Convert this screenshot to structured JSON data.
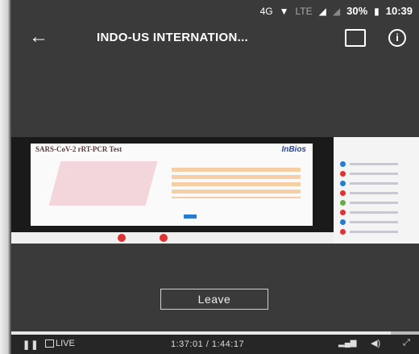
{
  "status_bar": {
    "network": "4G",
    "lte": "LTE",
    "battery": "30%",
    "time": "10:39"
  },
  "top_bar": {
    "back_icon": "arrow-left",
    "title": "INDO-US INTERNATION...",
    "chat_icon": "chat-bubble",
    "info_icon": "info-circle"
  },
  "video": {
    "slide_title": "SARS-CoV-2 rRT-PCR Test",
    "slide_logo": "InBios"
  },
  "leave_button": {
    "label": "Leave"
  },
  "controls": {
    "pause_icon": "pause",
    "live_label": "LIVE",
    "time": "1:37:01 / 1:44:17",
    "progress_fraction": 0.93,
    "signal_icon": "signal-bars",
    "volume_icon": "volume",
    "fullscreen_icon": "expand"
  }
}
